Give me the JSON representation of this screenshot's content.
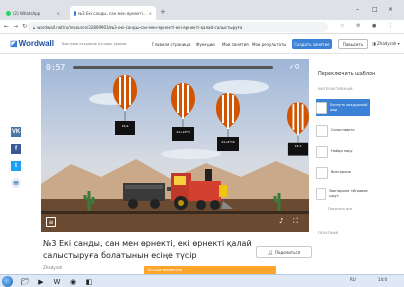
{
  "browser": {
    "tabs": [
      {
        "label": "(2) WhatsApp"
      },
      {
        "label": "№3 Екі санды, сан мен өрнекті..."
      }
    ],
    "url": "wordwall.net/ru/resource/32809903/№3-екі-санды-сан-мен-өрнекті-екі-өрнекті-қалай-салыстыруға"
  },
  "site": {
    "logo": "Wordwall",
    "tagline": "Быстрое создание лучших уроков",
    "nav": [
      "Главная страница",
      "Функции",
      "Мои занятия",
      "Мои результаты"
    ],
    "create_button": "Создать занятие",
    "upgrade_button": "Повысить",
    "user_name": "Zhadyrah"
  },
  "share_buttons": [
    "VK",
    "f",
    "t",
    "✉"
  ],
  "game": {
    "timer": "0:57",
    "score": "✓0",
    "balloon_labels": [
      "16-6",
      "24+18*3",
      "24+8*16",
      "16-3"
    ],
    "progress": 0
  },
  "right_panel": {
    "title": "Переключить шаблон",
    "section": "ИНТЕРАКТИВНЫЙ",
    "templates": [
      "Лопнуть воздушный шар",
      "Сопоставить",
      "Найди пару",
      "Викторина",
      "Викторина «Игровое шоу»"
    ],
    "show_all": "Показать все",
    "section2": "ПЕЧАТНЫЙ"
  },
  "page": {
    "title": "№3 Екі санды, сан мен өрнекті, екі өрнекті қалай салыстыруға болатынын есіңе түсір",
    "share_label": "Поделиться",
    "author": "Zhadyrah",
    "ad_text": "Больше форматов"
  },
  "taskbar": {
    "lang": "RU",
    "time": "14:0"
  }
}
